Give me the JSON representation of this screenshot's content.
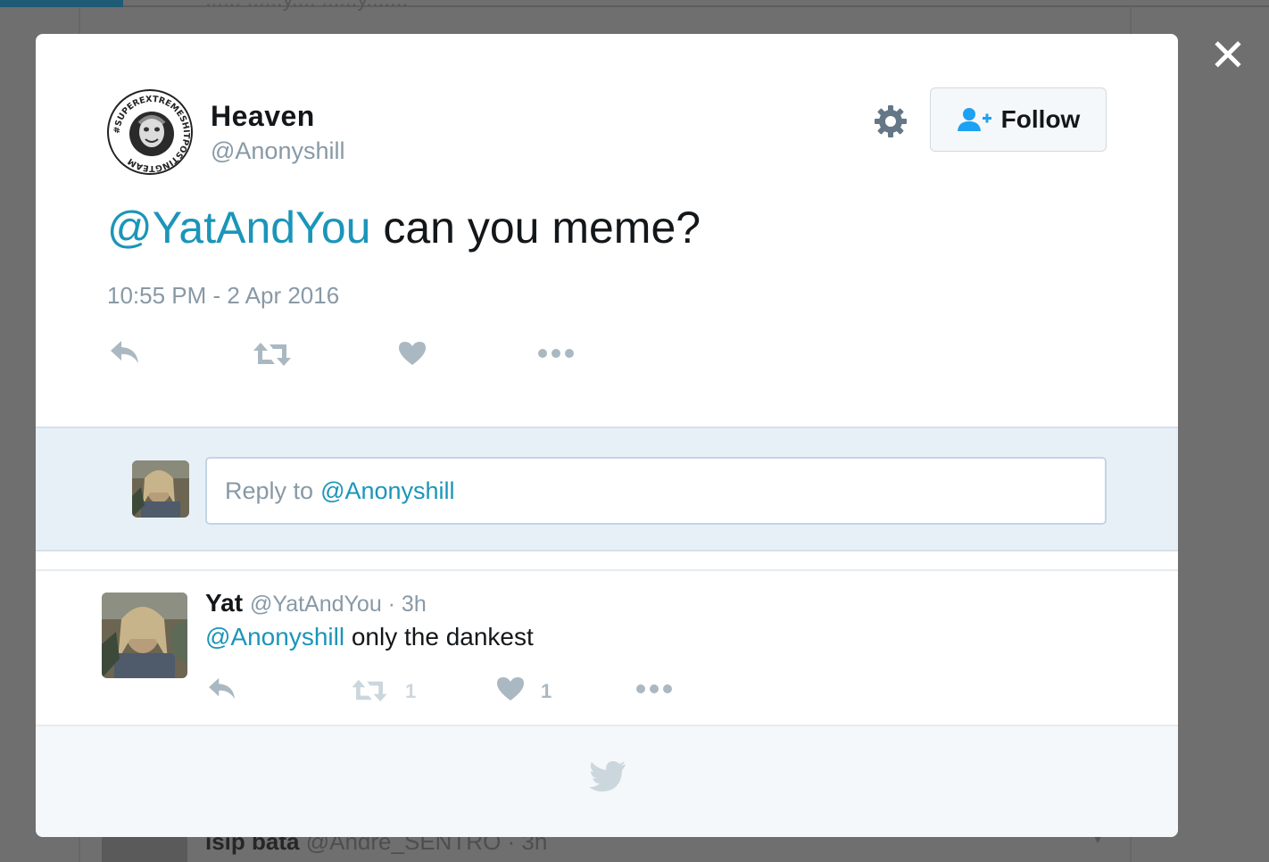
{
  "background": {
    "peek_text": "...... ......y.... ......y.......",
    "bottom_row": {
      "name": "isip bata",
      "handle": "@Andre_SENTRO · 3h"
    }
  },
  "modal": {
    "close_label": "✕",
    "tweet": {
      "display_name": "Heaven",
      "handle": "@Anonyshill",
      "avatar_ring_text": "#SUPEREXTREMESHITPOSTINGTEAM",
      "follow_label": "Follow",
      "text_mention": "@YatAndYou",
      "text_body": " can you meme?",
      "timestamp": "10:55 PM - 2 Apr 2016"
    },
    "reply_box": {
      "placeholder_prefix": "Reply to",
      "placeholder_mention": "@Anonyshill"
    },
    "reply": {
      "name": "Yat",
      "handle_time": "@YatAndYou · 3h",
      "mention": "@Anonyshill",
      "body": " only the dankest",
      "retweet_count": "1",
      "like_count": "1"
    }
  },
  "colors": {
    "link_blue": "#1b95b9",
    "icon_gray": "#aab8c2",
    "follow_icon_blue": "#1da1f2",
    "overlay": "#6f6f6f"
  },
  "icons": [
    "close-icon",
    "gear-icon",
    "follow-user-icon",
    "reply-icon",
    "retweet-icon",
    "heart-icon",
    "more-icon",
    "twitter-bird-icon"
  ]
}
